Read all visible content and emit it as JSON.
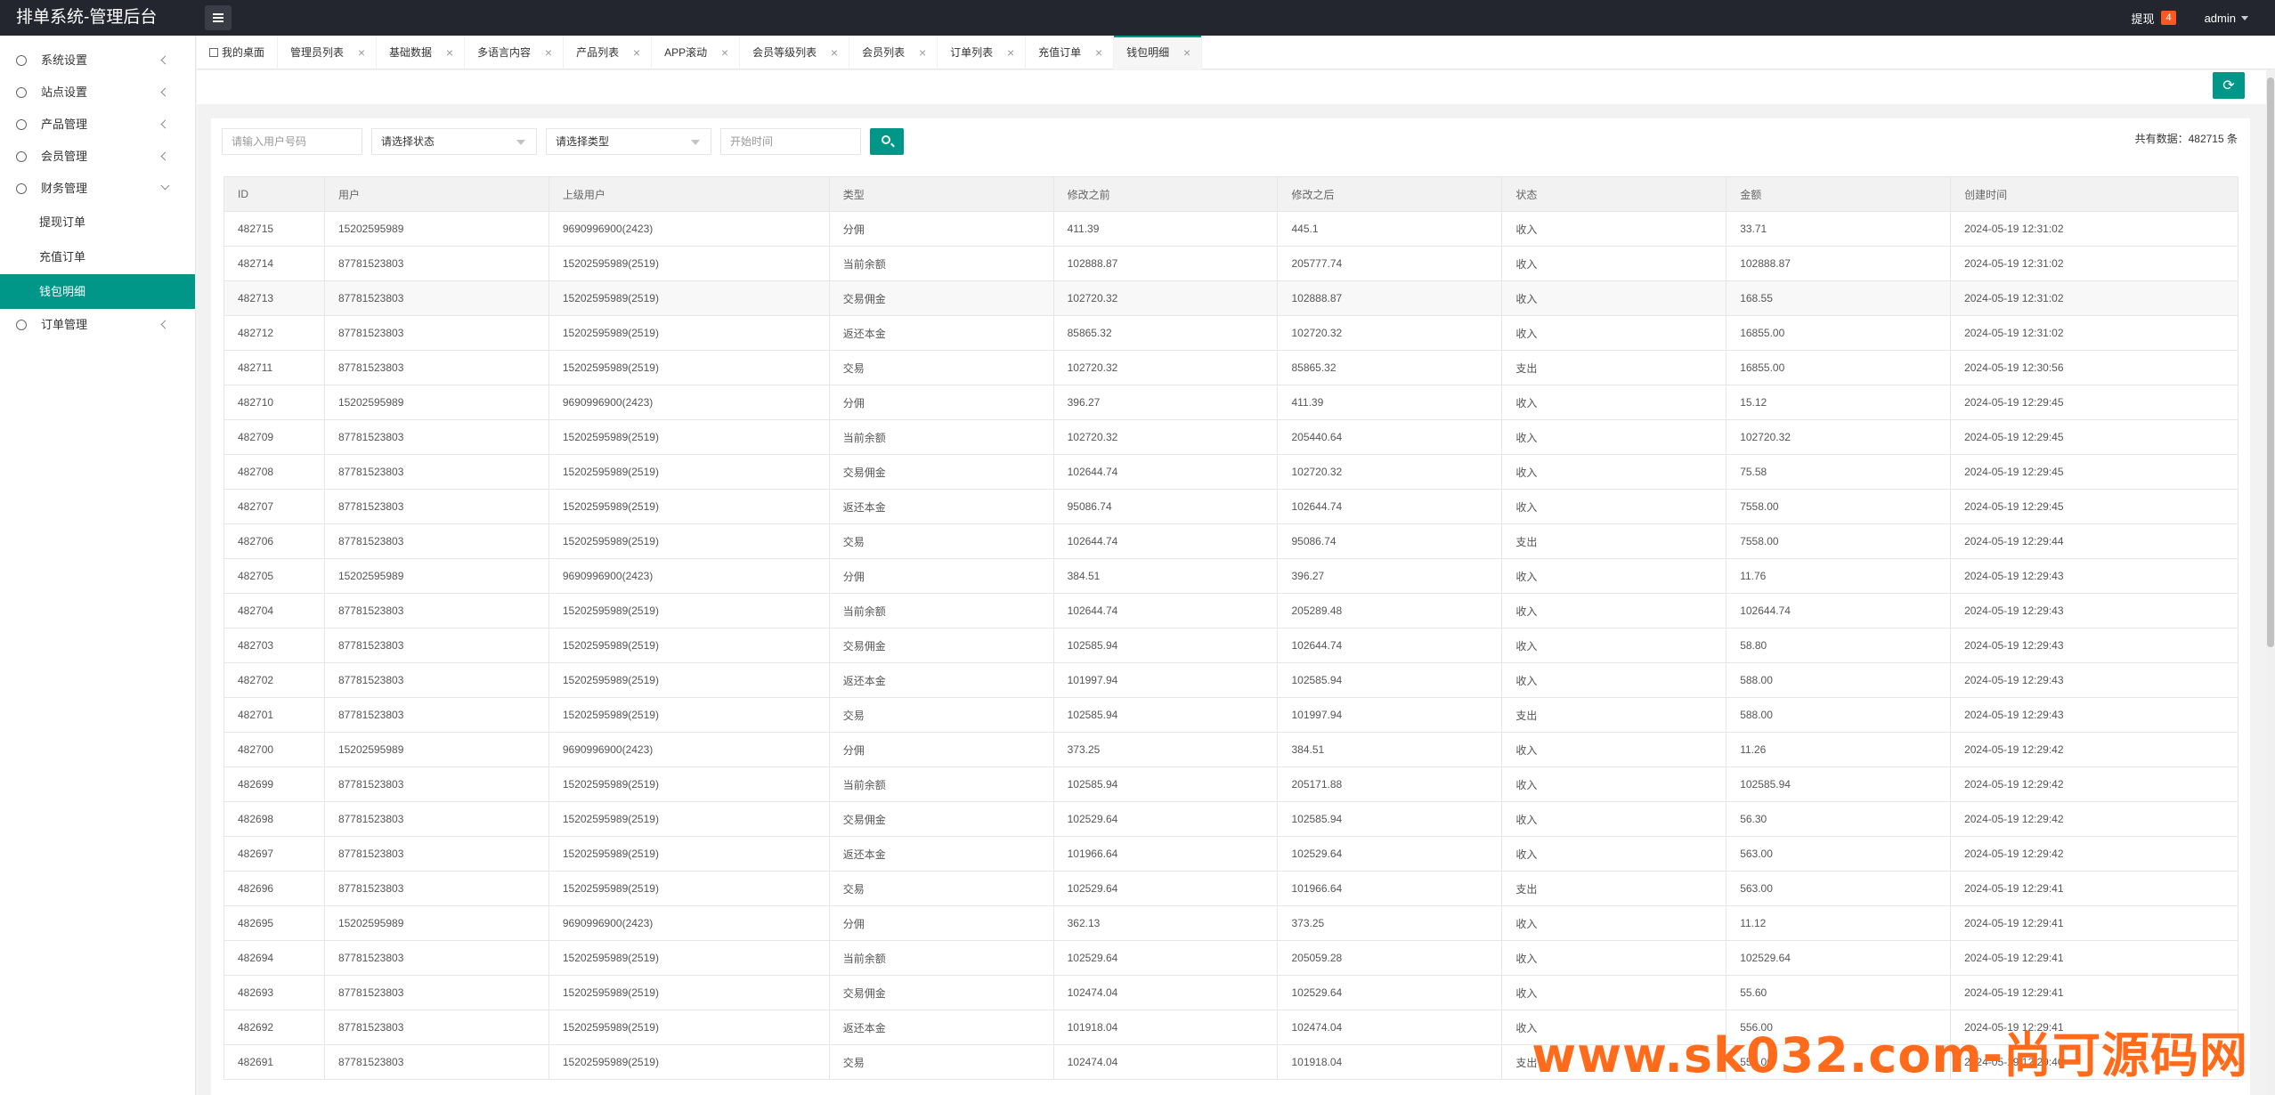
{
  "header": {
    "logo": "排单系统-管理后台",
    "withdraw_label": "提现",
    "withdraw_badge": "4",
    "user": "admin"
  },
  "sidebar": {
    "items": [
      {
        "label": "系统设置"
      },
      {
        "label": "站点设置"
      },
      {
        "label": "产品管理"
      },
      {
        "label": "会员管理"
      },
      {
        "label": "财务管理"
      }
    ],
    "sub_items": [
      {
        "label": "提现订单"
      },
      {
        "label": "充值订单"
      },
      {
        "label": "钱包明细"
      }
    ],
    "last_item": {
      "label": "订单管理"
    }
  },
  "tabs": [
    {
      "label": "我的桌面"
    },
    {
      "label": "管理员列表"
    },
    {
      "label": "基础数据"
    },
    {
      "label": "多语言内容"
    },
    {
      "label": "产品列表"
    },
    {
      "label": "APP滚动"
    },
    {
      "label": "会员等级列表"
    },
    {
      "label": "会员列表"
    },
    {
      "label": "订单列表"
    },
    {
      "label": "充值订单"
    },
    {
      "label": "钱包明细"
    }
  ],
  "filters": {
    "user_placeholder": "请输入用户号码",
    "status_select": "请选择状态",
    "type_select": "请选择类型",
    "time_placeholder": "开始时间"
  },
  "total": "共有数据：482715 条",
  "table": {
    "headers": [
      "ID",
      "用户",
      "上级用户",
      "类型",
      "修改之前",
      "修改之后",
      "状态",
      "金额",
      "创建时间"
    ],
    "rows": [
      [
        "482715",
        "15202595989",
        "9690996900(2423)",
        "分佣",
        "411.39",
        "445.1",
        "收入",
        "33.71",
        "2024-05-19 12:31:02"
      ],
      [
        "482714",
        "87781523803",
        "15202595989(2519)",
        "当前余额",
        "102888.87",
        "205777.74",
        "收入",
        "102888.87",
        "2024-05-19 12:31:02"
      ],
      [
        "482713",
        "87781523803",
        "15202595989(2519)",
        "交易佣金",
        "102720.32",
        "102888.87",
        "收入",
        "168.55",
        "2024-05-19 12:31:02"
      ],
      [
        "482712",
        "87781523803",
        "15202595989(2519)",
        "返还本金",
        "85865.32",
        "102720.32",
        "收入",
        "16855.00",
        "2024-05-19 12:31:02"
      ],
      [
        "482711",
        "87781523803",
        "15202595989(2519)",
        "交易",
        "102720.32",
        "85865.32",
        "支出",
        "16855.00",
        "2024-05-19 12:30:56"
      ],
      [
        "482710",
        "15202595989",
        "9690996900(2423)",
        "分佣",
        "396.27",
        "411.39",
        "收入",
        "15.12",
        "2024-05-19 12:29:45"
      ],
      [
        "482709",
        "87781523803",
        "15202595989(2519)",
        "当前余额",
        "102720.32",
        "205440.64",
        "收入",
        "102720.32",
        "2024-05-19 12:29:45"
      ],
      [
        "482708",
        "87781523803",
        "15202595989(2519)",
        "交易佣金",
        "102644.74",
        "102720.32",
        "收入",
        "75.58",
        "2024-05-19 12:29:45"
      ],
      [
        "482707",
        "87781523803",
        "15202595989(2519)",
        "返还本金",
        "95086.74",
        "102644.74",
        "收入",
        "7558.00",
        "2024-05-19 12:29:45"
      ],
      [
        "482706",
        "87781523803",
        "15202595989(2519)",
        "交易",
        "102644.74",
        "95086.74",
        "支出",
        "7558.00",
        "2024-05-19 12:29:44"
      ],
      [
        "482705",
        "15202595989",
        "9690996900(2423)",
        "分佣",
        "384.51",
        "396.27",
        "收入",
        "11.76",
        "2024-05-19 12:29:43"
      ],
      [
        "482704",
        "87781523803",
        "15202595989(2519)",
        "当前余额",
        "102644.74",
        "205289.48",
        "收入",
        "102644.74",
        "2024-05-19 12:29:43"
      ],
      [
        "482703",
        "87781523803",
        "15202595989(2519)",
        "交易佣金",
        "102585.94",
        "102644.74",
        "收入",
        "58.80",
        "2024-05-19 12:29:43"
      ],
      [
        "482702",
        "87781523803",
        "15202595989(2519)",
        "返还本金",
        "101997.94",
        "102585.94",
        "收入",
        "588.00",
        "2024-05-19 12:29:43"
      ],
      [
        "482701",
        "87781523803",
        "15202595989(2519)",
        "交易",
        "102585.94",
        "101997.94",
        "支出",
        "588.00",
        "2024-05-19 12:29:43"
      ],
      [
        "482700",
        "15202595989",
        "9690996900(2423)",
        "分佣",
        "373.25",
        "384.51",
        "收入",
        "11.26",
        "2024-05-19 12:29:42"
      ],
      [
        "482699",
        "87781523803",
        "15202595989(2519)",
        "当前余额",
        "102585.94",
        "205171.88",
        "收入",
        "102585.94",
        "2024-05-19 12:29:42"
      ],
      [
        "482698",
        "87781523803",
        "15202595989(2519)",
        "交易佣金",
        "102529.64",
        "102585.94",
        "收入",
        "56.30",
        "2024-05-19 12:29:42"
      ],
      [
        "482697",
        "87781523803",
        "15202595989(2519)",
        "返还本金",
        "101966.64",
        "102529.64",
        "收入",
        "563.00",
        "2024-05-19 12:29:42"
      ],
      [
        "482696",
        "87781523803",
        "15202595989(2519)",
        "交易",
        "102529.64",
        "101966.64",
        "支出",
        "563.00",
        "2024-05-19 12:29:41"
      ],
      [
        "482695",
        "15202595989",
        "9690996900(2423)",
        "分佣",
        "362.13",
        "373.25",
        "收入",
        "11.12",
        "2024-05-19 12:29:41"
      ],
      [
        "482694",
        "87781523803",
        "15202595989(2519)",
        "当前余额",
        "102529.64",
        "205059.28",
        "收入",
        "102529.64",
        "2024-05-19 12:29:41"
      ],
      [
        "482693",
        "87781523803",
        "15202595989(2519)",
        "交易佣金",
        "102474.04",
        "102529.64",
        "收入",
        "55.60",
        "2024-05-19 12:29:41"
      ],
      [
        "482692",
        "87781523803",
        "15202595989(2519)",
        "返还本金",
        "101918.04",
        "102474.04",
        "收入",
        "556.00",
        "2024-05-19 12:29:41"
      ],
      [
        "482691",
        "87781523803",
        "15202595989(2519)",
        "交易",
        "102474.04",
        "101918.04",
        "支出",
        "556.00",
        "2024-05-19 12:29:40"
      ]
    ]
  },
  "watermark": "www.sk032.com-尚可源码网"
}
